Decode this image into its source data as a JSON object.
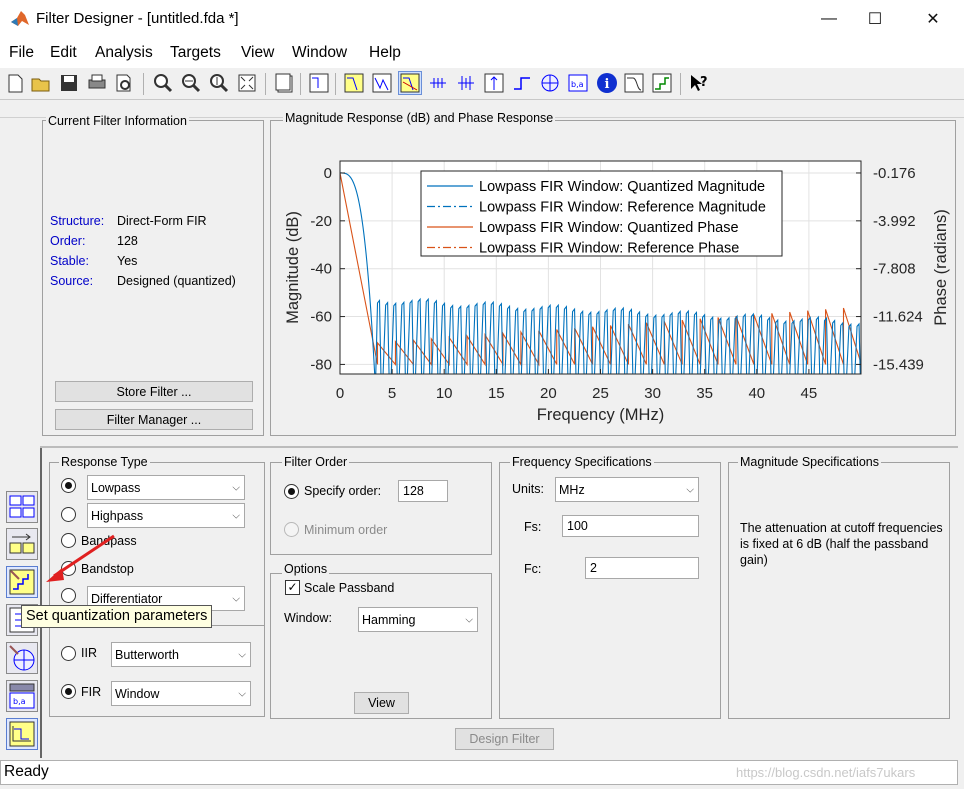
{
  "window": {
    "title": "Filter Designer -  [untitled.fda *]",
    "minimize": "—",
    "maximize": "☐",
    "close": "✕"
  },
  "menu": [
    "File",
    "Edit",
    "Analysis",
    "Targets",
    "View",
    "Window",
    "Help"
  ],
  "toolbar_icons": [
    "new-icon",
    "open-icon",
    "save-icon",
    "print-icon",
    "print-preview-icon",
    "zoom-in-icon",
    "zoom-x-icon",
    "zoom-y-icon",
    "full-view-icon",
    "new-figure-icon",
    "full-view-analysis-icon",
    "magnitude-response-icon",
    "phase-response-icon",
    "magnitude-phase-icon",
    "group-delay-icon",
    "phase-delay-icon",
    "impulse-response-icon",
    "step-response-icon",
    "pole-zero-icon",
    "coefficients-icon",
    "information-icon",
    "cost-icon",
    "round-off-noise-icon",
    "magnitude-response-estimate-icon",
    "whats-this-icon"
  ],
  "filter_info": {
    "title": "Current Filter Information",
    "rows": [
      {
        "key": "Structure:",
        "value": "Direct-Form FIR"
      },
      {
        "key": "Order:",
        "value": "128"
      },
      {
        "key": "Stable:",
        "value": "Yes"
      },
      {
        "key": "Source:",
        "value": "Designed (quantized)"
      }
    ],
    "store_button": "Store Filter ...",
    "manager_button": "Filter Manager ..."
  },
  "plot_panel_title": "Magnitude Response (dB) and Phase Response",
  "chart_data": {
    "type": "line",
    "xlabel": "Frequency (MHz)",
    "ylabel": "Magnitude (dB)",
    "y2label": "Phase (radians)",
    "xlim": [
      0,
      50
    ],
    "ylim": [
      -84,
      5
    ],
    "xticks": [
      "0",
      "5",
      "10",
      "15",
      "20",
      "25",
      "30",
      "35",
      "40",
      "45"
    ],
    "yticks": [
      "0",
      "-20",
      "-40",
      "-60",
      "-80"
    ],
    "y2ticks": [
      "-0.176",
      "-3.992",
      "-7.808",
      "-11.624",
      "-15.439"
    ],
    "legend_position": "top-right",
    "series": [
      {
        "name": "Lowpass FIR Window: Quantized Magnitude",
        "color": "#0072bd",
        "style": "solid",
        "passband_edge": 3,
        "stopband_peak_db": -54,
        "ripple_period_mhz": 0.78
      },
      {
        "name": "Lowpass FIR Window: Reference Magnitude",
        "color": "#0072bd",
        "style": "dashdot"
      },
      {
        "name": "Lowpass FIR Window: Quantized Phase",
        "color": "#d95319",
        "style": "solid"
      },
      {
        "name": "Lowpass FIR Window: Reference Phase",
        "color": "#d95319",
        "style": "dashdot"
      }
    ]
  },
  "response_type": {
    "title": "Response Type",
    "options": [
      {
        "label": "",
        "select": "Lowpass",
        "checked": true
      },
      {
        "label": "",
        "select": "Highpass",
        "checked": false
      },
      {
        "label": "Bandpass",
        "checked": false
      },
      {
        "label": "Bandstop",
        "checked": false
      },
      {
        "label": "",
        "select": "Differentiator",
        "checked": false
      }
    ],
    "iir_label": "IIR",
    "iir_select": "Butterworth",
    "fir_label": "FIR",
    "fir_select": "Window"
  },
  "tooltip": "Set quantization parameters",
  "filter_order": {
    "title": "Filter Order",
    "specify_label": "Specify order:",
    "specify_value": "128",
    "minimum_label": "Minimum order"
  },
  "options": {
    "title": "Options",
    "scale_label": "Scale Passband",
    "window_label": "Window:",
    "window_value": "Hamming",
    "view_button": "View"
  },
  "freq_specs": {
    "title": "Frequency Specifications",
    "units_label": "Units:",
    "units_value": "MHz",
    "fs_label": "Fs:",
    "fs_value": "100",
    "fc_label": "Fc:",
    "fc_value": "2"
  },
  "mag_specs": {
    "title": "Magnitude Specifications",
    "text": "The attenuation at cutoff frequencies is fixed at 6 dB (half the passband gain)"
  },
  "design_button": "Design Filter",
  "status": "Ready",
  "watermark": "https://blog.csdn.net/iafs7ukars"
}
